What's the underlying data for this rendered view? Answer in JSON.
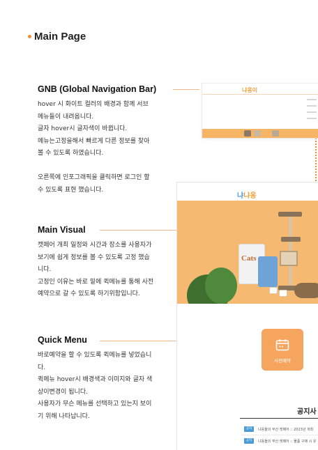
{
  "page": {
    "heading": "Main Page"
  },
  "colors": {
    "accent": "#f08a3c",
    "hero_bg": "#f6b972",
    "quick_tile": "#f5a55e",
    "notice_tag": "#4a9bd6"
  },
  "sections": {
    "gnb": {
      "title": "GNB (Global Navigation Bar)",
      "lines": [
        "hover 시 화이트 컬러의 배경과 함께 서브",
        "메뉴들이 내려옵니다.",
        "글자 hover시 글자색이 바뀝니다.",
        "메뉴는고정을해서 빠르게 다른 정보를 찾아",
        "볼 수 있도록 하였습니다.",
        "",
        "오른쪽에 인포그래픽을 클릭하면 로그인 할",
        "수 있도록 표현 했습니다."
      ]
    },
    "main_visual": {
      "title": "Main Visual",
      "lines": [
        "캣페어 개최 일정와 시간과 장소를 사용자가",
        "보기에 쉽게 정보를 볼 수 있도록 고정 했습",
        "니다.",
        "고정인 이유는 바로 밑에 퀵메뉴를 통해 사전",
        "예약으로 갈 수 있도록 하기위함입니다."
      ]
    },
    "quick_menu": {
      "title": "Quick Menu",
      "lines": [
        "바로예약을 할 수 있도록 퀵메뉴를 넣었습니",
        "다.",
        "퀵메뉴 hover시 배경색과 이미지와 글자 색",
        "상이변경이 됩니다.",
        "사용자가 무슨 메뉴를 선택하고 있는지 보이",
        "기 위해 나타납니다."
      ]
    }
  },
  "preview": {
    "logo_main": "냐옹",
    "logo_prefix": "냐",
    "gnb_logo": "냐옹이",
    "hero_product_label": "Cats",
    "quick_tile_label": "사전예약",
    "notice": {
      "title": "공지사",
      "rows": [
        {
          "tag": "공지",
          "text": "냐옹들의 부산 캣페어 :: 2023년 개최"
        },
        {
          "tag": "공지",
          "text": "냐옹들의 부산 캣페어 :: 물품 구매 시 유"
        }
      ]
    }
  }
}
